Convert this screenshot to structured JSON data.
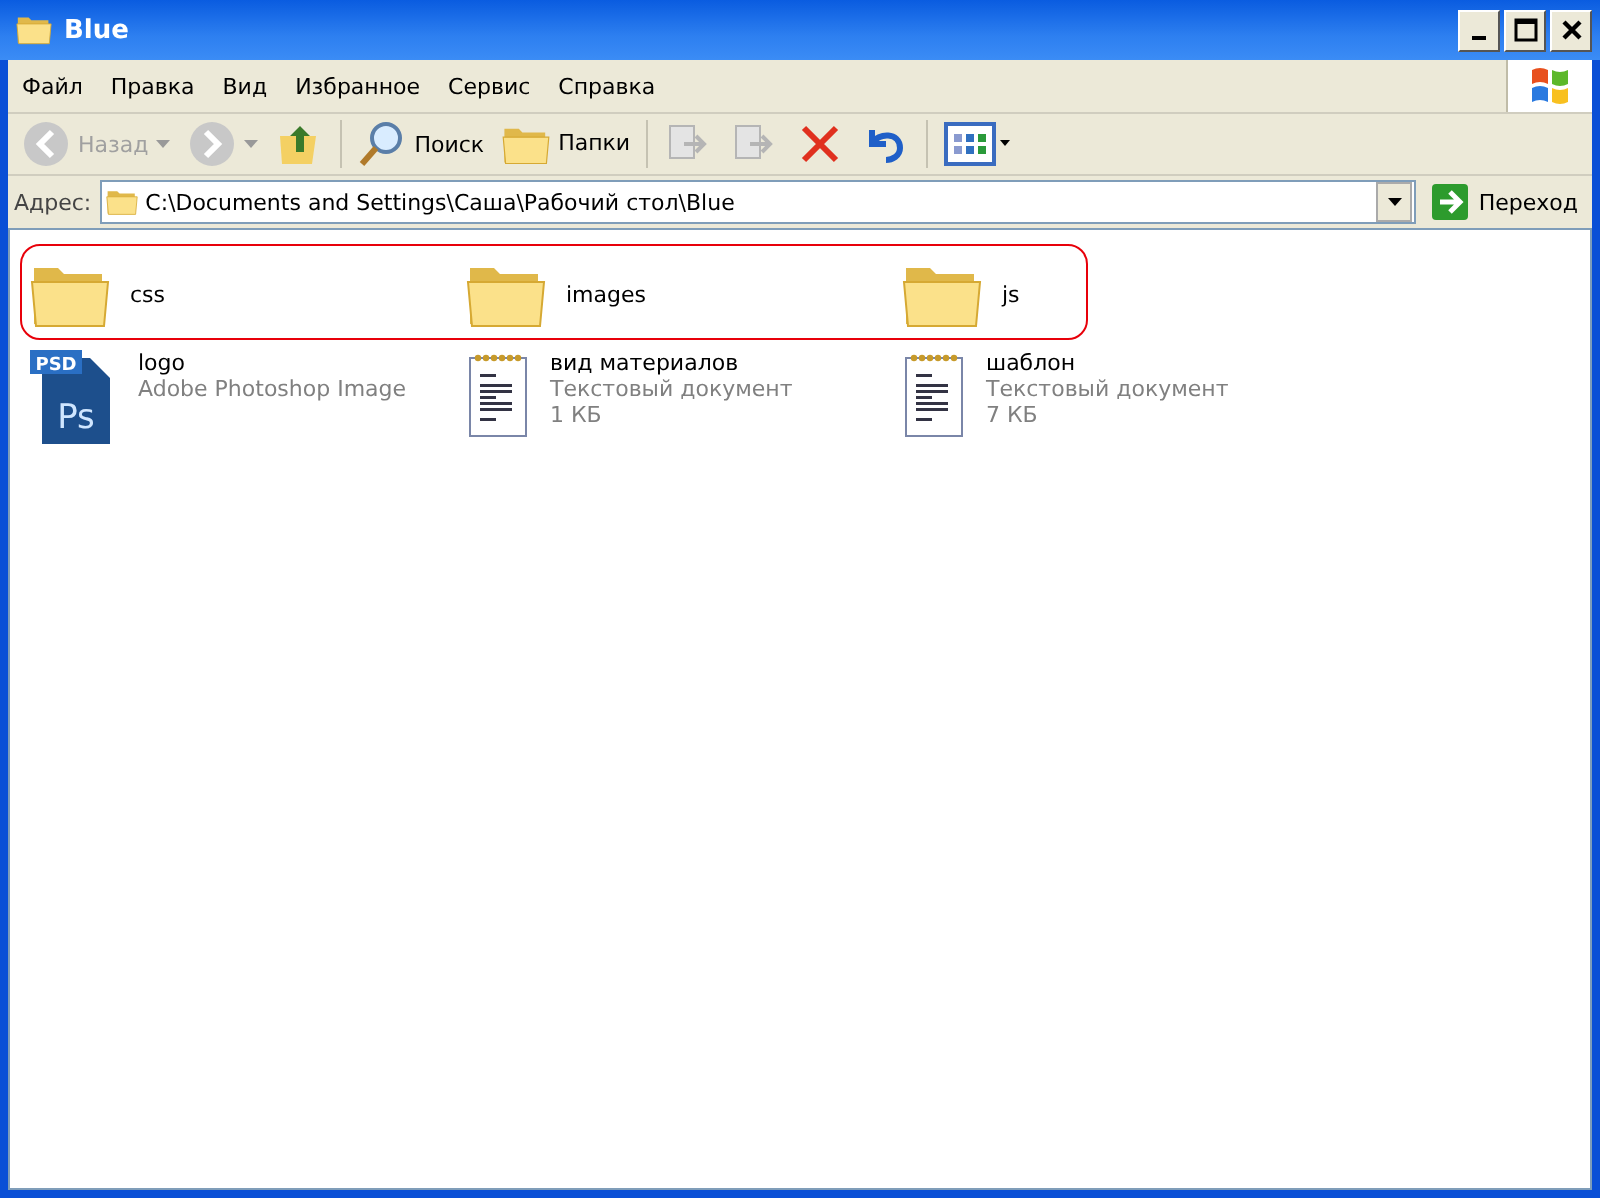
{
  "window": {
    "title": "Blue"
  },
  "menu": [
    "Файл",
    "Правка",
    "Вид",
    "Избранное",
    "Сервис",
    "Справка"
  ],
  "toolbar": [
    {
      "kind": "back",
      "label": "Назад",
      "disabled": true
    },
    {
      "kind": "forward",
      "disabled": true
    },
    {
      "kind": "up",
      "disabled": false
    },
    {
      "kind": "search",
      "label": "Поиск",
      "disabled": false
    },
    {
      "kind": "folders",
      "label": "Папки",
      "disabled": false
    },
    {
      "kind": "move",
      "disabled": true
    },
    {
      "kind": "copy",
      "disabled": true
    },
    {
      "kind": "delete",
      "disabled": false
    },
    {
      "kind": "undo",
      "disabled": false
    },
    {
      "kind": "views",
      "disabled": false
    }
  ],
  "address": {
    "label": "Адрес:",
    "value": "C:\\Documents and Settings\\Саша\\Рабочий стол\\Blue",
    "go": "Переход"
  },
  "folders": [
    {
      "name": "css"
    },
    {
      "name": "images"
    },
    {
      "name": "js"
    }
  ],
  "files": [
    {
      "kind": "psd",
      "name": "logo",
      "type": "Adobe Photoshop Image",
      "badge": "PSD",
      "glyph": "Ps"
    },
    {
      "kind": "text",
      "name": "вид материалов",
      "type": "Текстовый документ",
      "size": "1 КБ"
    },
    {
      "kind": "text",
      "name": "шаблон",
      "type": "Текстовый документ",
      "size": "7 КБ"
    }
  ]
}
